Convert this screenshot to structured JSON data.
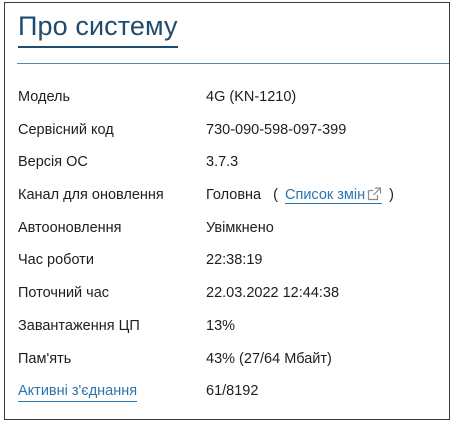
{
  "title": "Про систему",
  "rows": [
    {
      "label": "Модель",
      "value": "4G (KN-1210)"
    },
    {
      "label": "Сервісний код",
      "value": "730-090-598-097-399"
    },
    {
      "label": "Версія ОС",
      "value": "3.7.3"
    },
    {
      "label": "Канал для оновлення",
      "value": "Головна",
      "link_text": "Список змін",
      "paren_open": "(",
      "paren_close": ")"
    },
    {
      "label": "Автооновлення",
      "value": "Увімкнено"
    },
    {
      "label": "Час роботи",
      "value": "22:38:19"
    },
    {
      "label": "Поточний час",
      "value": "22.03.2022 12:44:38"
    },
    {
      "label": "Завантаження ЦП",
      "value": "13%"
    },
    {
      "label": "Пам'ять",
      "value": "43% (27/64 Мбайт)"
    },
    {
      "label": "Активні з'єднання",
      "value": "61/8192"
    }
  ],
  "icons": {
    "external_link": "external-link-icon"
  },
  "colors": {
    "title": "#1f4c6e",
    "link": "#2a74ad",
    "rule": "#4f8ab6"
  }
}
